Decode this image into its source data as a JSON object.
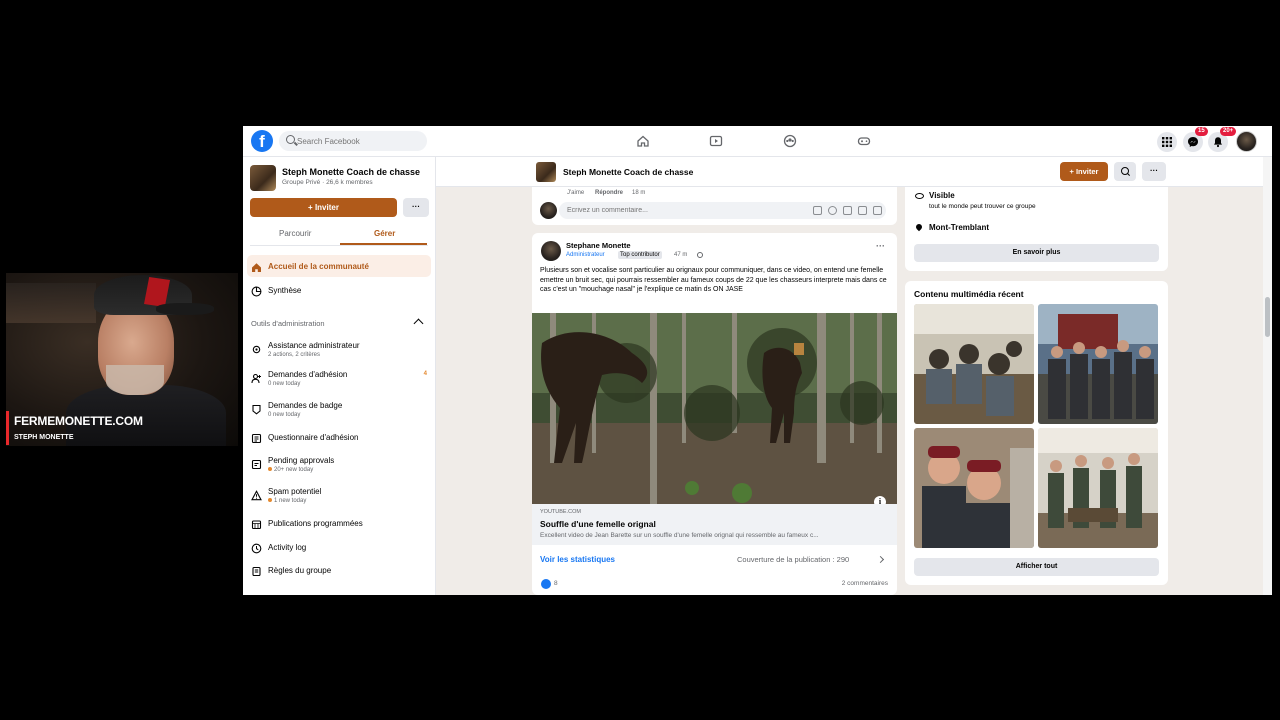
{
  "topbar": {
    "search_placeholder": "Search Facebook",
    "messenger_badge": "15",
    "notifications_badge": "20+"
  },
  "sidebar": {
    "group_name": "Steph Monette Coach de chasse",
    "group_meta": "Groupe Privé · 26,6 k membres",
    "invite_label": "+ Inviter",
    "more_label": "···",
    "tabs": [
      "Parcourir",
      "Gérer"
    ],
    "active_item": "Accueil de la communauté",
    "summary_item": "Synthèse",
    "admin_section_title": "Outils d'administration",
    "items": [
      {
        "label": "Assistance administrateur",
        "sub": "2 actions, 2 critères",
        "dot": false,
        "count": ""
      },
      {
        "label": "Demandes d'adhésion",
        "sub": "0 new today",
        "dot": false,
        "count": "4"
      },
      {
        "label": "Demandes de badge",
        "sub": "0 new today",
        "dot": false,
        "count": ""
      },
      {
        "label": "Questionnaire d'adhésion",
        "sub": "",
        "dot": false,
        "count": ""
      },
      {
        "label": "Pending approvals",
        "sub": "20+ new today",
        "dot": true,
        "count": ""
      },
      {
        "label": "Spam potentiel",
        "sub": "1 new today",
        "dot": true,
        "count": ""
      },
      {
        "label": "Publications programmées",
        "sub": "",
        "dot": false,
        "count": ""
      },
      {
        "label": "Activity log",
        "sub": "",
        "dot": false,
        "count": ""
      },
      {
        "label": "Règles du groupe",
        "sub": "",
        "dot": false,
        "count": ""
      }
    ]
  },
  "group_header": {
    "name": "Steph Monette Coach de chasse",
    "invite_label": "+ Inviter",
    "more_label": "···"
  },
  "comment_box": {
    "like_label": "J'aime",
    "reply_label": "Répondre",
    "time": "18 m",
    "placeholder": "Écrivez un commentaire..."
  },
  "post": {
    "author": "Stephane Monette",
    "role": "Administrateur",
    "tag": "Top contributor",
    "time": "47 m",
    "text": "Plusieurs son et vocalise sont particulier au orignaux pour communiquer,  dans ce video, on entend une femelle emettre un bruit sec, qui pourrais ressembler au fameux coups de 22 que les chasseurs interprete mais dans ce cas c'est un \"mouchage nasal\" je l'explique ce matin ds ON JASE",
    "link_domain": "YOUTUBE.COM",
    "link_title": "Souffle d'une femelle orignal",
    "link_desc": "Excellent video de Jean Barette sur un souffle d'une femelle orignal qui ressemble au fameux c...",
    "stats_label": "Voir les statistiques",
    "reach_label": "Couverture de la publication : 290",
    "likes": "8",
    "comments": "2 commentaires"
  },
  "about": {
    "visible_label": "Visible",
    "visible_sub": "tout le monde peut trouver ce groupe",
    "location": "Mont-Tremblant",
    "learn_more": "En savoir plus"
  },
  "media": {
    "title": "Contenu multimédia récent",
    "see_all": "Afficher tout"
  },
  "webcam": {
    "title": "FERMEMONETTE.COM",
    "subtitle": "STEPH MONETTE"
  },
  "colors": {
    "accent": "#b05a1a",
    "facebook_blue": "#1877f2",
    "badge_red": "#e41e3f"
  }
}
